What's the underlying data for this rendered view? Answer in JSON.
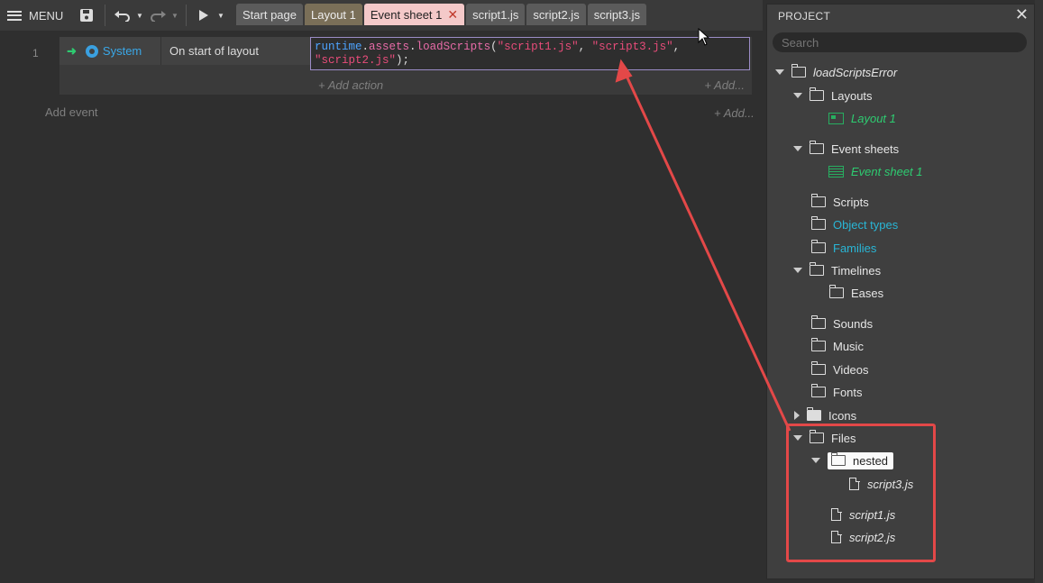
{
  "toolbar": {
    "menu_label": "MENU",
    "tabs": [
      {
        "label": "Start page"
      },
      {
        "label": "Layout 1"
      },
      {
        "label": "Event sheet 1"
      },
      {
        "label": "script1.js"
      },
      {
        "label": "script2.js"
      },
      {
        "label": "script3.js"
      }
    ],
    "close_glyph": "✕"
  },
  "sheet": {
    "row_number": "1",
    "condition_object": "System",
    "condition_text": "On start of layout",
    "code": {
      "p1": "runtime",
      "p2": ".",
      "p3": "assets",
      "p4": ".",
      "p5": "loadScripts",
      "p6": "(",
      "s1": "\"script1.js\"",
      "c1": ", ",
      "s2": "\"script3.js\"",
      "c2": ",",
      "s3": "\"script2.js\"",
      "end": ");"
    },
    "add_action": "+ Add action",
    "add_right": "+ Add...",
    "add_event": "Add event",
    "add_right2": "+ Add..."
  },
  "project": {
    "title": "PROJECT",
    "search_placeholder": "Search",
    "root": "loadScriptsError",
    "layouts": "Layouts",
    "layout1": "Layout 1",
    "event_sheets": "Event sheets",
    "event_sheet1": "Event sheet 1",
    "scripts": "Scripts",
    "object_types": "Object types",
    "families": "Families",
    "timelines": "Timelines",
    "eases": "Eases",
    "sounds": "Sounds",
    "music": "Music",
    "videos": "Videos",
    "fonts": "Fonts",
    "icons": "Icons",
    "files": "Files",
    "nested": "nested",
    "script3": "script3.js",
    "script1": "script1.js",
    "script2": "script2.js"
  },
  "colors": {
    "annotation": "#e34848",
    "active_tab": "#f4c9c9",
    "green": "#2ecc71",
    "cyan": "#29b6d6"
  }
}
